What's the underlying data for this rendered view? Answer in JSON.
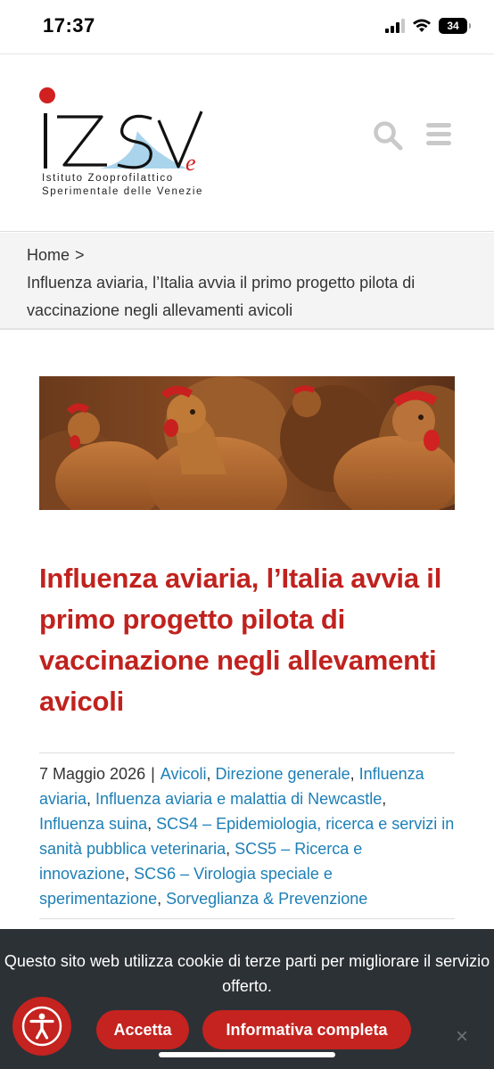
{
  "status_bar": {
    "time": "17:37",
    "battery": "34",
    "icons": [
      "signal-icon",
      "wifi-icon",
      "battery-icon"
    ]
  },
  "header": {
    "logo_line1": "Istituto Zooprofilattico",
    "logo_line2": "Sperimentale delle Venezie",
    "icons": [
      "search-icon",
      "menu-icon"
    ]
  },
  "breadcrumb": {
    "home": "Home",
    "separator": ">",
    "current": "Influenza aviaria, l’Italia avvia il primo progetto pilota di vaccinazione negli allevamenti avicoli"
  },
  "article": {
    "title": "Influenza aviaria, l’Italia avvia il primo progetto pilota di vaccinazione negli allevamenti avicoli",
    "date": "7 Maggio 2026",
    "meta_separator": "|",
    "categories": [
      "Avicoli",
      "Direzione generale",
      "Influenza aviaria",
      "Influenza aviaria e malattia di Newcastle",
      "Influenza suina",
      "SCS4 – Epidemiologia, ricerca e servizi in sanità pubblica veterinaria",
      "SCS5 – Ricerca e innovazione",
      "SCS6 – Virologia speciale e sperimentazione",
      "Sorveglianza & Prevenzione"
    ]
  },
  "cookie_banner": {
    "message": "Questo sito web utilizza cookie di terze parti per migliorare il servizio offerto.",
    "accept_label": "Accetta",
    "info_label": "Informativa completa",
    "close_label": "×"
  },
  "colors": {
    "accent": "#c0221e",
    "link": "#1d7fb6",
    "banner_bg": "#2c3136"
  }
}
